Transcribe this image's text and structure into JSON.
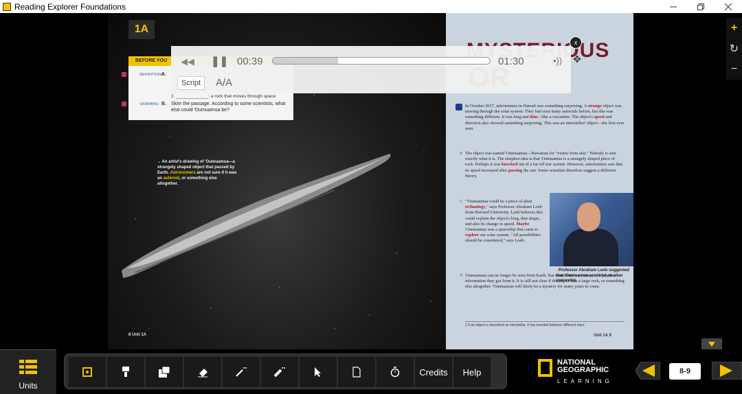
{
  "window": {
    "title": "Reading Explorer Foundations",
    "buttons": [
      "minimize",
      "restore",
      "close"
    ]
  },
  "book": {
    "left_page": {
      "unit_tag": "1A",
      "before_you_read": "BEFORE YOU",
      "definitions_label": "DEFINITIONS",
      "definitions_letter": "A.",
      "def_line": "2. _____________: a rock that moves through space",
      "skimming_label": "SKIMMING",
      "skimming_letter": "B.",
      "skimming_text": "Skim the passage. According to some scientists, what else could 'Oumuamua be?",
      "caption_a": "An artist's drawing of 'Oumuamua—a strangely shaped object that passed by Earth.",
      "caption_kw1": "Astronomers",
      "caption_b": "are not sure if it was an",
      "caption_kw2": "asteroid",
      "caption_c": ", or something else altogether.",
      "page_number": "8 Unit 1A"
    },
    "right_page": {
      "title_line1": "MYSTERIOUS",
      "title_line2": "OR",
      "para_a": {
        "letter": "A",
        "t1": "In October 2017, astronomers in Hawaii saw something surprising. A",
        "k1": "strange",
        "t2": "object was moving through the solar system. They had seen many asteroids before, but this was something different. It was long and",
        "k2": "thin",
        "t3": "—like a cucumber. The object's",
        "k3": "speed",
        "t4": "and direction also showed something surprising. This was an interstellar¹ object—the first ever seen."
      },
      "para_b": {
        "letter": "B",
        "t1": "The object was named 'Oumuamua—Hawaiian for \"visitor from afar.\" Nobody is sure exactly what it is. The simplest idea is that 'Oumuamua is a strangely shaped piece of rock. Perhaps it was",
        "k1": "knocked",
        "t2": "out of a far-off star system. However, astronomers saw that its speed increased after",
        "k2": "passing",
        "t3": "the sun. Some scientists therefore suggest a different theory."
      },
      "para_c": {
        "letter": "C",
        "t1": "\"'Oumuamua could be a piece of alien",
        "k1": "technology",
        "t2": ",\" says Professor Abraham Loeb from Harvard University. Loeb believes this could explain the object's long, thin shape, and also its change in speed.",
        "k2": "Maybe",
        "t3": "'Oumuamua was a spaceship that came to",
        "k3": "explore",
        "t4": "our solar system. \"All possibilities should be considered,\" says Loeb."
      },
      "para_d": {
        "letter": "D",
        "t1": "'Oumuamua can no longer be seen from Earth. But astronomers continue to study the information they got from it. It is still not clear if the object was a large rock, or something else altogether. 'Oumuamua will likely be a mystery for many years to come."
      },
      "photo_caption": "Professor Abraham Loeb suggested that 'Oumuamua could be an alien spaceship.",
      "footnote": "1 If an object is described as interstellar, it has traveled between different stars.",
      "page_number": "Unit 1A 9"
    }
  },
  "audio_player": {
    "current_time": "00:39",
    "total_time": "01:30",
    "progress_fraction": 0.3,
    "script_label": "Script",
    "text_size_label": "A/A",
    "close_label": "x"
  },
  "zoom_controls": {
    "zoom_in": "+",
    "reset": "↻",
    "zoom_out": "−"
  },
  "toolbar": {
    "units_label": "Units",
    "credits_label": "Credits",
    "help_label": "Help",
    "page_field": "8-9",
    "brand_line1": "NATIONAL",
    "brand_line2": "GEOGRAPHIC",
    "brand_line3": "LEARNING",
    "accent_color": "#f2c200"
  }
}
